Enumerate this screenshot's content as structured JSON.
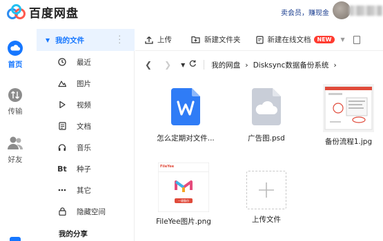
{
  "app": {
    "title": "百度网盘"
  },
  "top_links": {
    "vip": "卖会员，赚现金"
  },
  "rail": {
    "items": [
      {
        "label": "首页",
        "icon": "cloud-icon"
      },
      {
        "label": "传输",
        "icon": "transfer-icon"
      },
      {
        "label": "好友",
        "icon": "friends-icon"
      }
    ]
  },
  "sidenav": {
    "header": "我的文件",
    "items": [
      {
        "label": "最近",
        "icon": "clock-icon"
      },
      {
        "label": "图片",
        "icon": "image-icon"
      },
      {
        "label": "视频",
        "icon": "play-icon"
      },
      {
        "label": "文档",
        "icon": "document-icon"
      },
      {
        "label": "音乐",
        "icon": "headphones-icon"
      },
      {
        "label": "种子",
        "icon": "bt-icon",
        "glyph": "Bt"
      },
      {
        "label": "其它",
        "icon": "more-icon"
      },
      {
        "label": "隐藏空间",
        "icon": "lock-icon"
      }
    ],
    "share": "我的分享"
  },
  "toolbar": {
    "upload": "上传",
    "new_folder": "新建文件夹",
    "new_online_doc": "新建在线文档",
    "new_badge": "NEW"
  },
  "path": {
    "crumbs": [
      "我的网盘",
      "Disksync数据备份系统"
    ]
  },
  "files": [
    {
      "name": "怎么定期对文件...",
      "type": "word"
    },
    {
      "name": "广告图.psd",
      "type": "psd"
    },
    {
      "name": "备份流程1.jpg",
      "type": "image"
    },
    {
      "name": "FileYee图片.png",
      "type": "image"
    },
    {
      "name": "上传文件",
      "type": "upload"
    }
  ],
  "thumb_texts": {
    "fileyee_brand": "FileYee",
    "fileyee_button": "一键备份"
  },
  "colors": {
    "accent": "#1677ff",
    "word": "#2f7cf6",
    "badge": "#ff3b30",
    "psd": "#c9ced8"
  }
}
